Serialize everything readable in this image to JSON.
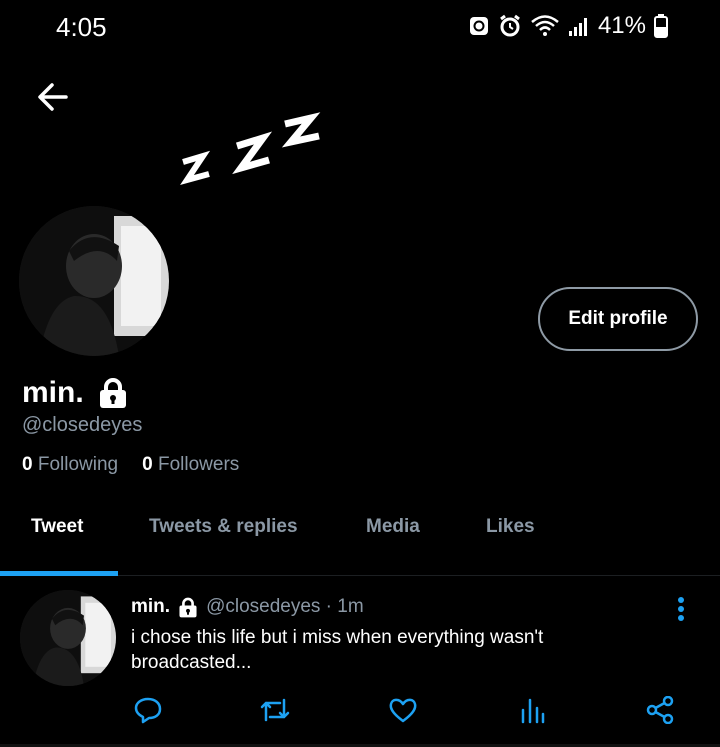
{
  "status_bar": {
    "time": "4:05",
    "battery": "41%",
    "icons": [
      "recycle-icon",
      "alarm-icon",
      "wifi-icon",
      "signal-icon",
      "battery-icon"
    ]
  },
  "header": {
    "back_icon": "arrow-left-icon",
    "decoration": "zzz-sleep-icon"
  },
  "profile": {
    "edit_button_label": "Edit profile",
    "display_name": "min.",
    "handle": "@closedeyes",
    "following_count": "0",
    "following_label": "Following",
    "followers_count": "0",
    "followers_label": "Followers",
    "lock_icon": "lock-icon"
  },
  "tabs": [
    {
      "label": "Tweet",
      "active": true
    },
    {
      "label": "Tweets & replies",
      "active": false
    },
    {
      "label": "Media",
      "active": false
    },
    {
      "label": "Likes",
      "active": false
    }
  ],
  "tweet": {
    "name": "min.",
    "handle_time": "@closedeyes · 1m",
    "text": "i chose this life but i miss when everything wasn't broadcasted...",
    "actions": [
      "reply-icon",
      "retweet-icon",
      "like-icon",
      "stats-icon",
      "share-icon"
    ]
  },
  "colors": {
    "background": "#000000",
    "secondary_text": "#8b98a5",
    "accent": "#1da1f2",
    "action_icon": "#1da1f2"
  }
}
